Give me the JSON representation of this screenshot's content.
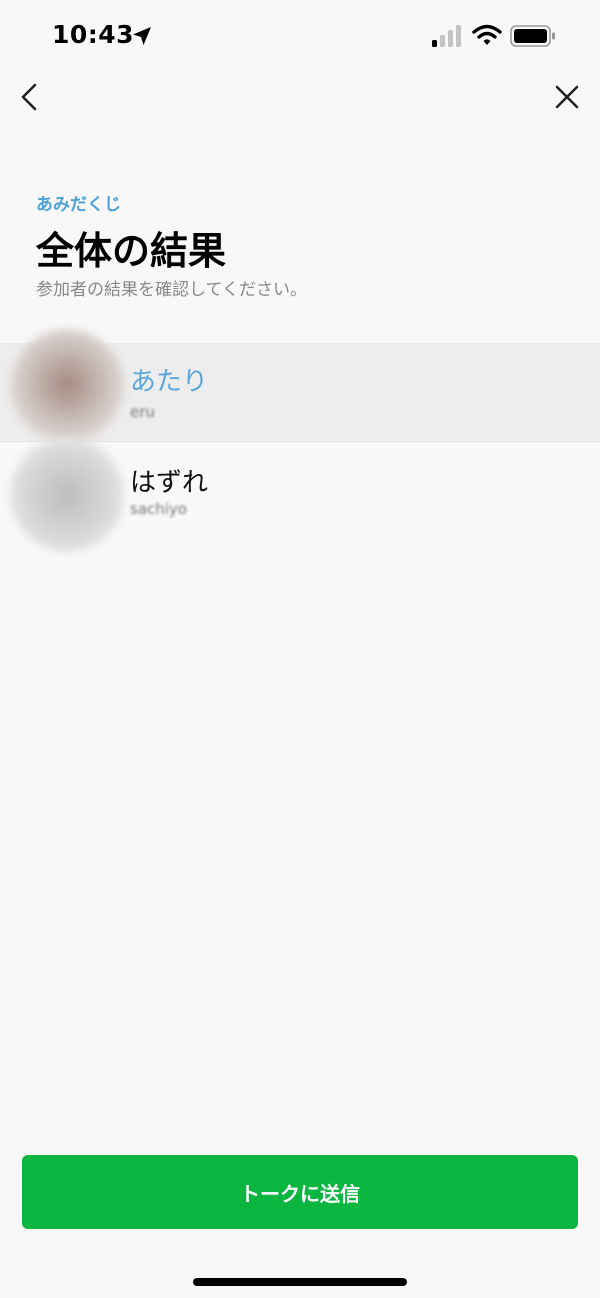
{
  "status_bar": {
    "time": "10:43",
    "location_icon": "location-arrow-icon",
    "signal_icon": "cellular-signal-icon",
    "wifi_icon": "wifi-icon",
    "battery_icon": "battery-icon"
  },
  "nav": {
    "back_icon": "chevron-left-icon",
    "close_icon": "close-icon"
  },
  "header": {
    "eyebrow": "あみだくじ",
    "title": "全体の結果",
    "subtitle": "参加者の結果を確認してください。"
  },
  "results": [
    {
      "result": "あたり",
      "participant": "eru",
      "highlighted": true
    },
    {
      "result": "はずれ",
      "participant": "sachiyo",
      "highlighted": false
    }
  ],
  "footer": {
    "send_label": "トークに送信"
  },
  "colors": {
    "accent_blue": "#4fa2d6",
    "send_green": "#0ab540",
    "background": "#f8f8f8",
    "highlight_row": "#ededed"
  }
}
